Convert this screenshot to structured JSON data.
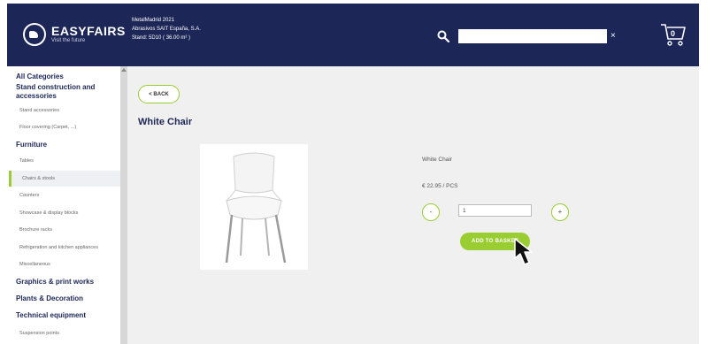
{
  "header": {
    "logo_name": "EASYFAIRS",
    "logo_tagline": "Visit the future",
    "event_line1": "MetalMadrid 2021",
    "event_line2": "Abrasivos SAIT España, S.A.",
    "event_line3": "Stand: 5D10 ( 36.00 m² )",
    "search_value": "",
    "clear_symbol": "×",
    "cart_count": "0"
  },
  "sidebar": {
    "all_categories": "All Categories",
    "stand_construction": "Stand construction and accessories",
    "stand_accessories": "Stand accessories",
    "floor_covering": "Floor covering (Carpet, ...)",
    "furniture": "Furniture",
    "tables": "Tables",
    "chairs_stools": "Chairs & stools",
    "counters": "Counters",
    "showcase": "Showcase & display blocks",
    "brochure": "Brochure racks",
    "refrigeration": "Refrigeration and kitchen appliances",
    "miscellaneous": "Miscellaneous",
    "graphics": "Graphics & print works",
    "plants": "Plants & Decoration",
    "technical": "Technical equipment",
    "suspension": "Suspension points"
  },
  "product": {
    "back_label": "< BACK",
    "title": "White Chair",
    "name": "White Chair",
    "price": "€ 22.95 / PCS",
    "minus_label": "-",
    "plus_label": "+",
    "quantity": "1",
    "add_label": "ADD TO BASKET"
  },
  "colors": {
    "header_bg": "#1d2757",
    "accent_green": "#9acd32"
  }
}
